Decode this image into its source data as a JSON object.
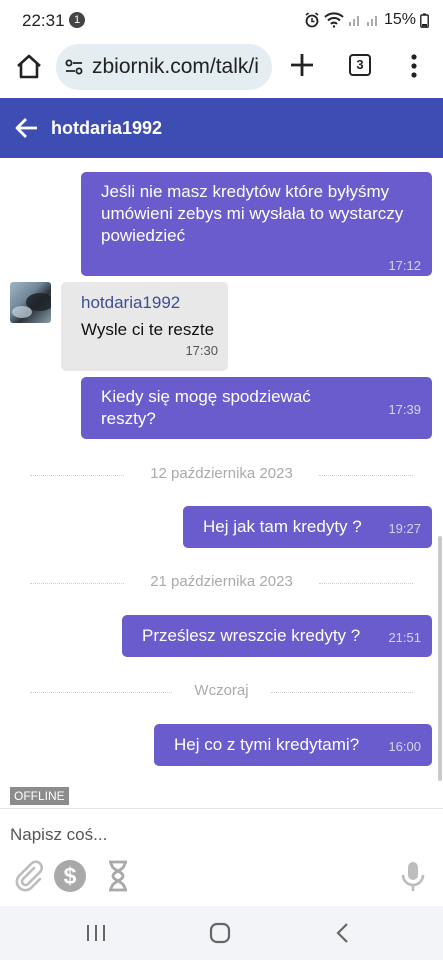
{
  "status_bar": {
    "time": "22:31",
    "notification_count": "1",
    "battery": "15%"
  },
  "browser": {
    "url": "zbiornik.com/talk/i",
    "tab_count": "3"
  },
  "header": {
    "title": "hotdaria1992"
  },
  "messages": [
    {
      "text": "Jeśli nie masz kredytów które byłyśmy umówieni zebys mi wysłała to wystarczy powiedzieć",
      "time": "17:12"
    },
    {
      "sender": "hotdaria1992",
      "text": "Wysle ci te reszte",
      "time": "17:30"
    },
    {
      "text": "Kiedy się mogę spodziewać reszty?",
      "time": "17:39"
    },
    {
      "date": "12 października 2023"
    },
    {
      "text": "Hej jak tam kredyty ?",
      "time": "19:27"
    },
    {
      "date": "21 października 2023"
    },
    {
      "text": "Prześlesz wreszcie kredyty ?",
      "time": "21:51"
    },
    {
      "date": "Wczoraj"
    },
    {
      "text": "Hej co z tymi kredytami?",
      "time": "16:00"
    }
  ],
  "status_label": "OFFLINE",
  "composer": {
    "placeholder": "Napisz coś..."
  },
  "colors": {
    "header": "#3e4db3",
    "outgoing_bubble": "#6a5ccc",
    "incoming_bubble": "#e8e8e8"
  },
  "icons": [
    "home-icon",
    "site-settings-icon",
    "plus-icon",
    "tabs-icon",
    "more-vert-icon",
    "back-arrow-icon",
    "paperclip-icon",
    "dollar-icon",
    "hourglass-icon",
    "microphone-icon",
    "recents-icon",
    "home-nav-icon",
    "back-nav-icon"
  ]
}
